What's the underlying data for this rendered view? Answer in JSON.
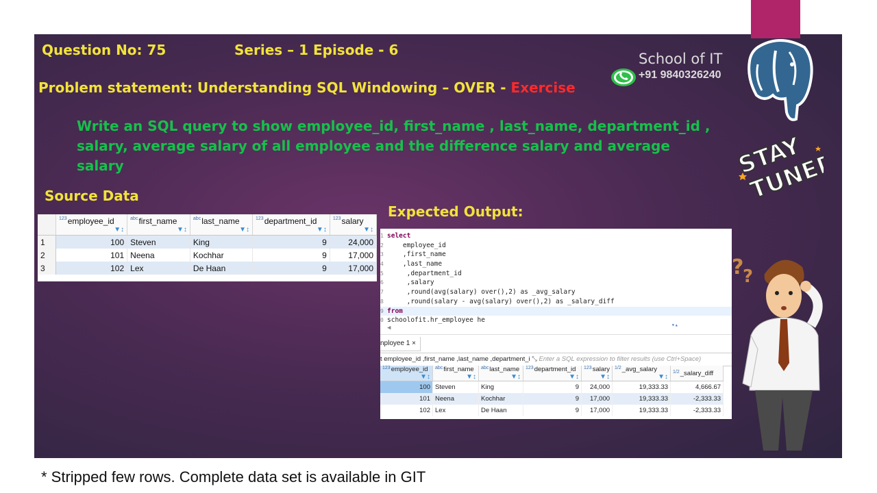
{
  "header": {
    "question_no": "Question No: 75",
    "series": "Series – 1 Episode - 6",
    "problem_prefix": "Problem statement: Understanding SQL Windowing – OVER - ",
    "problem_exercise": "Exercise",
    "task": "Write an SQL query to show employee_id, first_name , last_name, department_id , salary, average salary of all employee and the difference salary and average salary"
  },
  "branding": {
    "school": "School of IT",
    "phone": "+91 9840326240",
    "sticker_text": "STAY TUNED"
  },
  "source": {
    "title": "Source Data",
    "columns": [
      "employee_id",
      "first_name",
      "last_name",
      "department_id",
      "salary"
    ],
    "rows": [
      {
        "n": "1",
        "employee_id": "100",
        "first_name": "Steven",
        "last_name": "King",
        "department_id": "9",
        "salary": "24,000"
      },
      {
        "n": "2",
        "employee_id": "101",
        "first_name": "Neena",
        "last_name": "Kochhar",
        "department_id": "9",
        "salary": "17,000"
      },
      {
        "n": "3",
        "employee_id": "102",
        "first_name": "Lex",
        "last_name": "De Haan",
        "department_id": "9",
        "salary": "17,000"
      }
    ]
  },
  "output": {
    "title": "Expected Output:",
    "code": [
      {
        "ln": "1",
        "kw": "select",
        "text": ""
      },
      {
        "ln": "2",
        "kw": "",
        "text": "    employee_id"
      },
      {
        "ln": "3",
        "kw": "",
        "text": "    ,first_name"
      },
      {
        "ln": "4",
        "kw": "",
        "text": "    ,last_name"
      },
      {
        "ln": "5",
        "kw": "",
        "text": "     ,department_id"
      },
      {
        "ln": "6",
        "kw": "",
        "text": "     ,salary"
      },
      {
        "ln": "7",
        "kw": "",
        "text": "     ,round(avg(salary) over(),2) as _avg_salary"
      },
      {
        "ln": "8",
        "kw": "",
        "text": "     ,round(salary - avg(salary) over(),2) as _salary_diff"
      },
      {
        "ln": "9",
        "kw": "from",
        "text": ""
      },
      {
        "ln": "0",
        "kw": "",
        "text": "schoolofit.hr_employee he"
      }
    ],
    "tab_label": "nployee 1 ×",
    "filter_text": "t employee_id ,first_name ,last_name ,department_i",
    "filter_placeholder": "Enter a SQL expression to filter results (use Ctrl+Space)",
    "columns": [
      "employee_id",
      "first_name",
      "last_name",
      "department_id",
      "salary",
      "_avg_salary",
      "_salary_diff"
    ],
    "rows": [
      {
        "employee_id": "100",
        "first_name": "Steven",
        "last_name": "King",
        "department_id": "9",
        "salary": "24,000",
        "avg_salary": "19,333.33",
        "salary_diff": "4,666.67"
      },
      {
        "employee_id": "101",
        "first_name": "Neena",
        "last_name": "Kochhar",
        "department_id": "9",
        "salary": "17,000",
        "avg_salary": "19,333.33",
        "salary_diff": "-2,333.33"
      },
      {
        "employee_id": "102",
        "first_name": "Lex",
        "last_name": "De Haan",
        "department_id": "9",
        "salary": "17,000",
        "avg_salary": "19,333.33",
        "salary_diff": "-2,333.33"
      }
    ]
  },
  "footnote": "* Stripped few rows. Complete data set is available in GIT",
  "colors": {
    "heading_yellow": "#f2e33a",
    "task_green": "#17c04b",
    "exercise_red": "#ff2a2a",
    "slide_purple": "#4a2a52",
    "accent_pink": "#b0246a"
  }
}
